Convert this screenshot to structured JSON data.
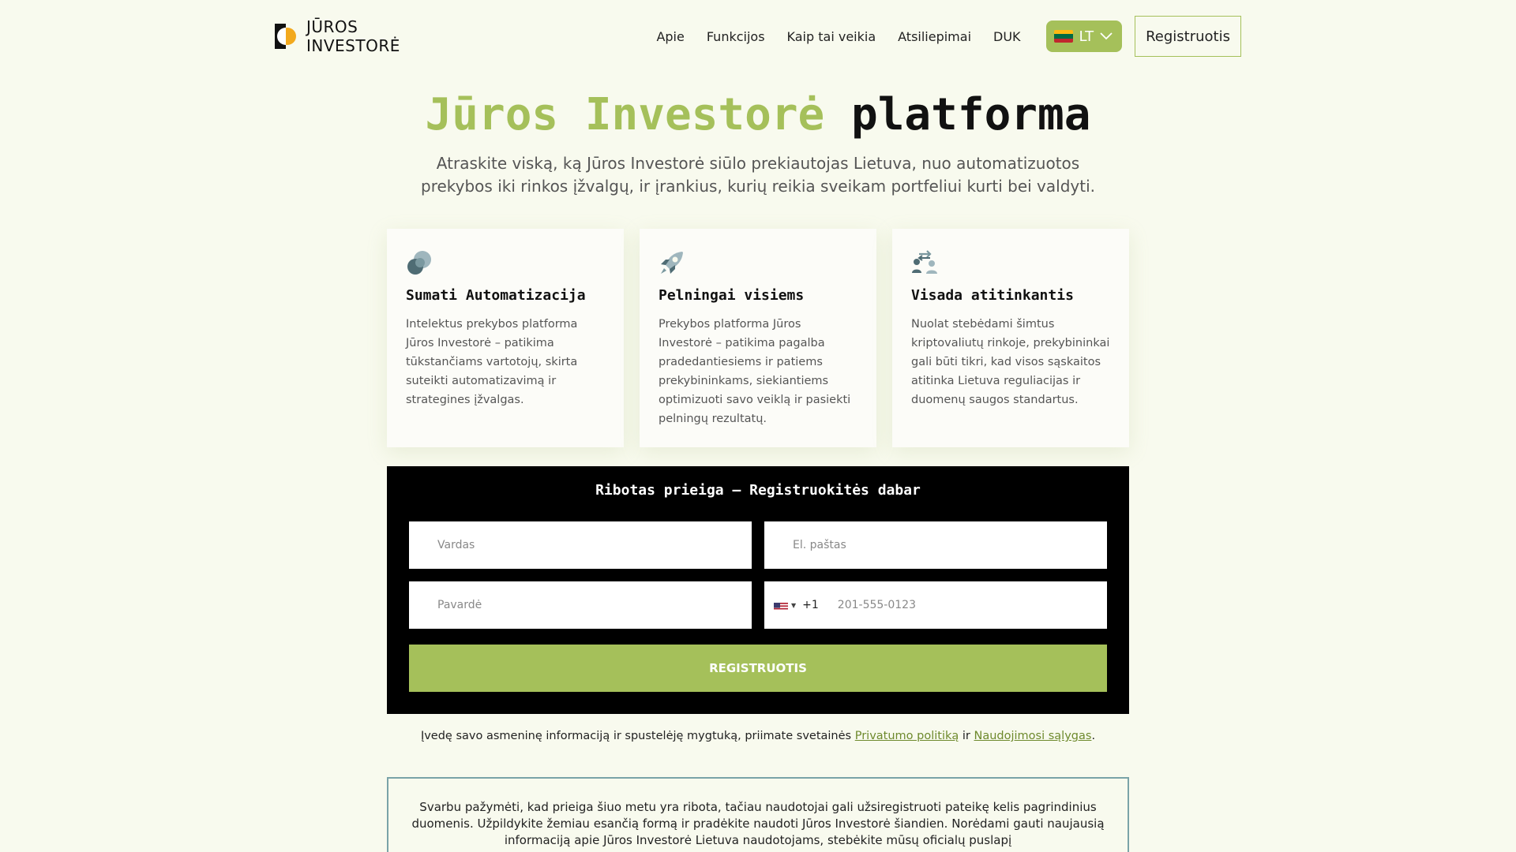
{
  "header": {
    "logo_line1": "JŪROS",
    "logo_line2": "INVESTORĖ",
    "nav": [
      "Apie",
      "Funkcijos",
      "Kaip tai veikia",
      "Atsiliepimai",
      "DUK"
    ],
    "lang": "LT",
    "register_label": "Registruotis"
  },
  "hero": {
    "title_accent": "Jūros Investorė",
    "title_plain": "platforma",
    "subtitle": "Atraskite viską, ką Jūros Investorė siūlo prekiautojas Lietuva, nuo automatizuotos prekybos iki rinkos įžvalgų, ir įrankius, kurių reikia sveikam portfeliui kurti bei valdyti."
  },
  "cards": [
    {
      "icon": "coins-icon",
      "title": "Sumati Automatizacija",
      "text": "Intelektus prekybos platforma Jūros Investorė – patikima tūkstančiams vartotojų, skirta suteikti automatizavimą ir strategines įžvalgas."
    },
    {
      "icon": "rocket-icon",
      "title": "Pelningai visiems",
      "text": "Prekybos platforma Jūros Investorė – patikima pagalba pradedantiesiems ir patiems prekybininkams, siekiantiems optimizuoti savo veiklą ir pasiekti pelningų rezultatų."
    },
    {
      "icon": "exchange-icon",
      "title": "Visada atitinkantis",
      "text": "Nuolat stebėdami šimtus kriptovaliutų rinkoje, prekybininkai gali būti tikri, kad visos sąskaitos atitinka Lietuva reguliacijas ir duomenų saugos standartus."
    }
  ],
  "form": {
    "title": "Ribotas prieiga – Registruokitės dabar",
    "first_name_placeholder": "Vardas",
    "email_placeholder": "El. paštas",
    "last_name_placeholder": "Pavardė",
    "dial_code": "+1",
    "phone_placeholder": "201-555-0123",
    "submit_label": "REGISTRUOTIS"
  },
  "consent": {
    "text_before": "Įvedę savo asmeninę informaciją ir spustelėję mygtuką, priimate svetainės ",
    "privacy_link": "Privatumo politiką",
    "middle": " ir ",
    "terms_link": "Naudojimosi sąlygas",
    "end": "."
  },
  "notice": {
    "text": "Svarbu pažymėti, kad prieiga šiuo metu yra ribota, tačiau naudotojai gali užsiregistruoti pateikę kelis pagrindinius duomenis. Užpildykite žemiau esančią formą ir pradėkite naudoti Jūros Investorė šiandien. Norėdami gauti naujausią informaciją apie Jūros Investorė Lietuva naudotojams, stebėkite mūsų oficialų puslapį"
  },
  "colors": {
    "accent": "#a5c05a",
    "background": "#f8faee",
    "form_bg": "#000000",
    "notice_border": "#7aa3a8"
  }
}
